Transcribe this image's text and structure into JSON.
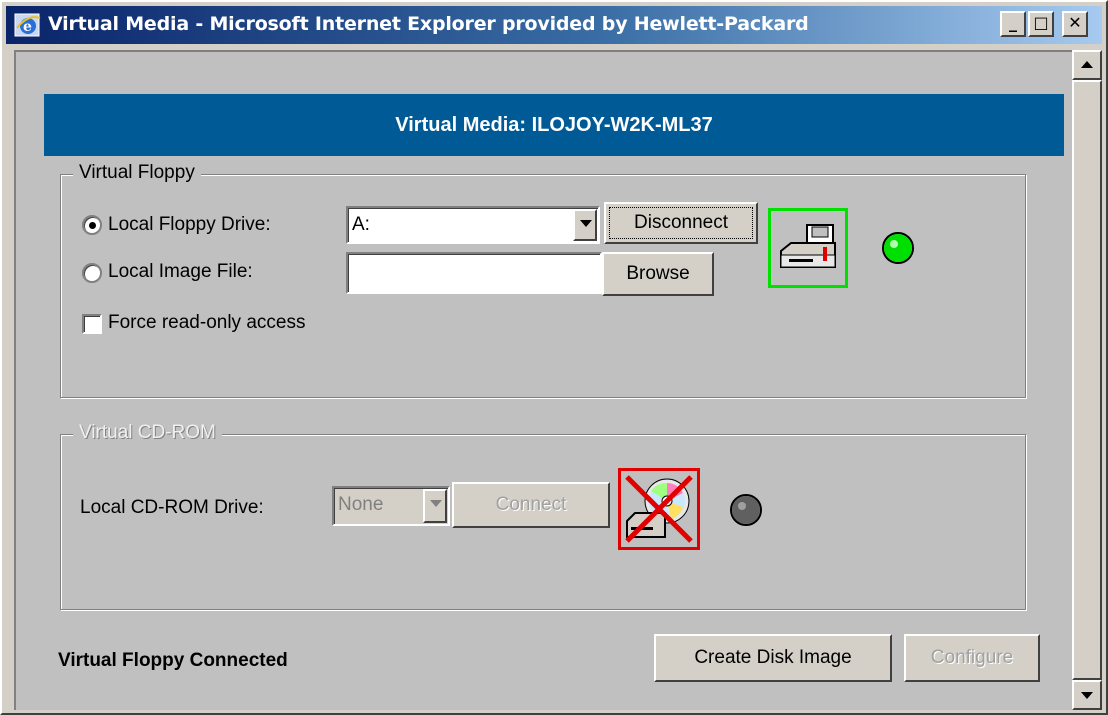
{
  "window": {
    "title": "Virtual Media - Microsoft Internet Explorer provided by Hewlett-Packard",
    "minimize_glyph": "_",
    "maximize_glyph": "□",
    "close_glyph": "✕"
  },
  "header": {
    "title": "Virtual Media: ILOJOY-W2K-ML37",
    "background": "#005a96"
  },
  "floppy": {
    "legend": "Virtual Floppy",
    "local_drive_label": "Local Floppy Drive:",
    "local_drive_selected": true,
    "drive_value": "A:",
    "disconnect_label": "Disconnect",
    "image_file_label": "Local Image File:",
    "image_file_value": "",
    "browse_label": "Browse",
    "force_readonly_label": "Force read-only access",
    "force_readonly_checked": false,
    "icon": "floppy-drive-icon",
    "status_color": "#00e000",
    "frame_color": "#00e000"
  },
  "cdrom": {
    "legend": "Virtual CD-ROM",
    "drive_label": "Local CD-ROM Drive:",
    "drive_value": "None",
    "connect_label": "Connect",
    "icon": "cdrom-drive-disabled-icon",
    "status_color": "#606060",
    "frame_color": "#e00000"
  },
  "footer": {
    "status_text": "Virtual Floppy Connected",
    "create_disk_image_label": "Create Disk Image",
    "configure_label": "Configure"
  }
}
